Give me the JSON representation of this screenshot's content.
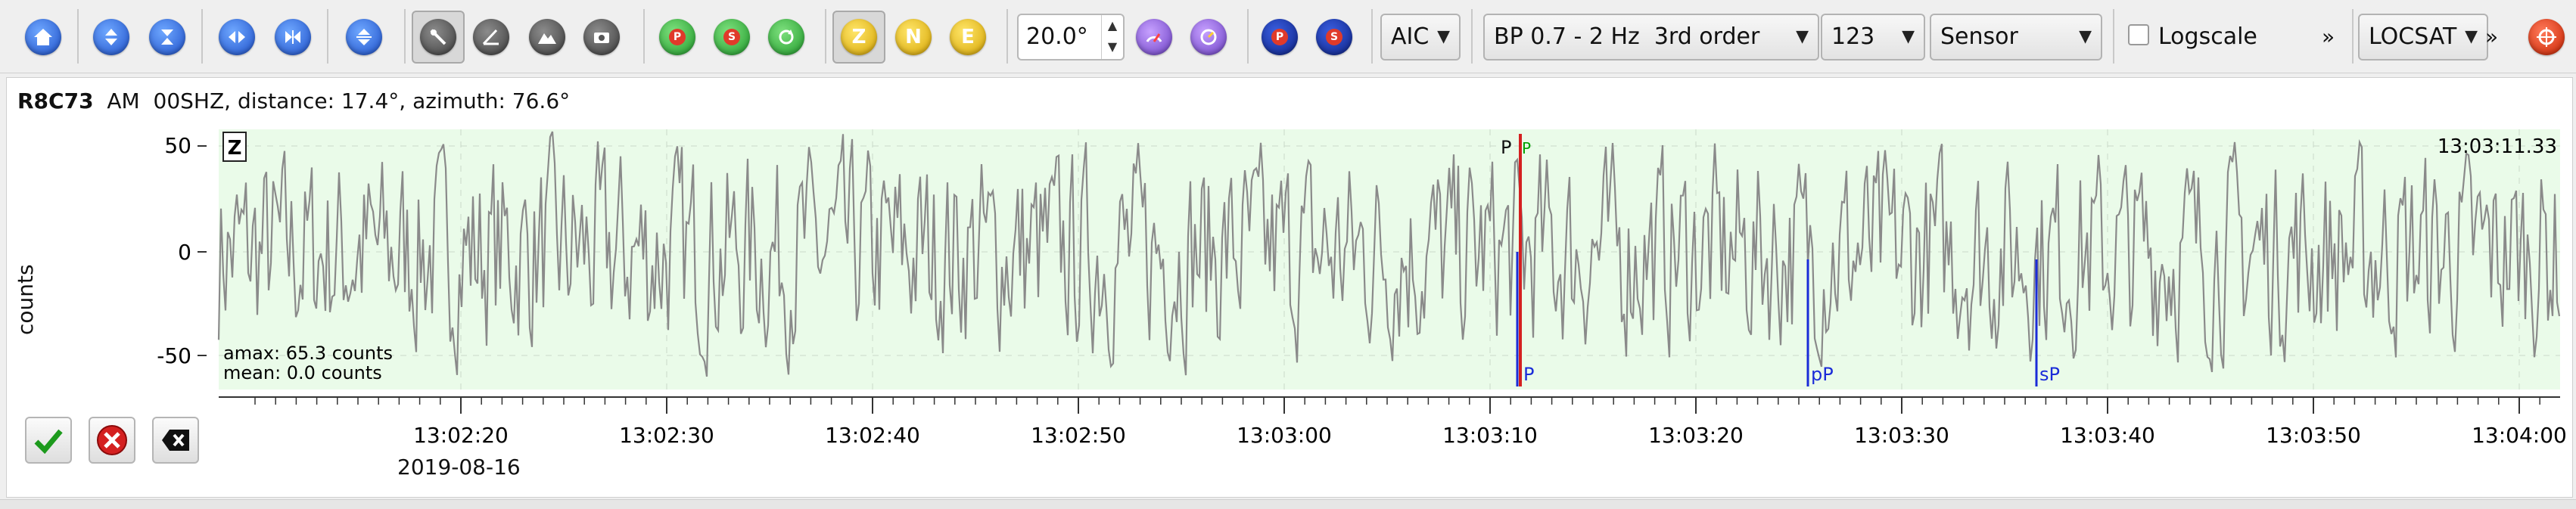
{
  "toolbar": {
    "zoom_value": "20.0°",
    "picker_method": "AIC",
    "filter": "BP 0.7 - 2 Hz  3rd order",
    "stream_count": "123",
    "unit_mode": "Sensor",
    "logscale_label": "Logscale",
    "logscale_checked": false,
    "overflow_glyph": "»",
    "locator": "LOCSAT",
    "buttons": {
      "p_label": "P",
      "s_label": "S",
      "z_label": "Z",
      "n_label": "N",
      "e_label": "E",
      "p2_label": "P",
      "s2_label": "S"
    }
  },
  "trace": {
    "station_code": "R8C73",
    "network": "AM",
    "channel": "00SHZ",
    "info": "distance: 17.4°, azimuth: 76.6°",
    "component_badge": "Z",
    "ylabel": "counts",
    "yticks": [
      "50",
      "0",
      "-50"
    ],
    "time_label": "13:03:11.33",
    "amax": "amax: 65.3 counts",
    "mean": "mean: 0.0 counts",
    "date": "2019-08-16",
    "xticks": [
      "13:02:20",
      "13:02:30",
      "13:02:40",
      "13:02:50",
      "13:03:00",
      "13:03:10",
      "13:03:20",
      "13:03:30",
      "13:03:40",
      "13:03:50",
      "13:04:00"
    ],
    "picks": [
      {
        "label": "P",
        "kind": "manual",
        "color": "#111111"
      },
      {
        "label": "P",
        "kind": "automatic",
        "color": "#00a000"
      },
      {
        "label": "P",
        "kind": "theoretical",
        "color": "#1a2bd8"
      },
      {
        "label": "pP",
        "kind": "theoretical",
        "color": "#1a2bd8"
      },
      {
        "label": "sP",
        "kind": "theoretical",
        "color": "#1a2bd8"
      }
    ]
  },
  "colors": {
    "trace_bg": "#eafbe9",
    "waveform": "#8a8a8a",
    "theoretical": "#1a2bd8",
    "manual_pick": "#d42020",
    "grid": "#c9d9c9"
  }
}
